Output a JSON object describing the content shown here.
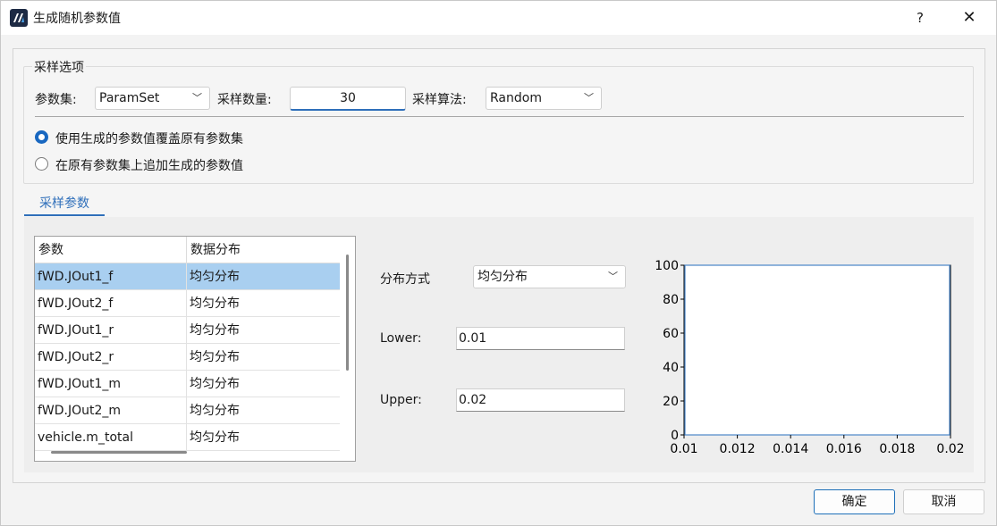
{
  "window": {
    "title": "生成随机参数值",
    "help_label": "?",
    "close_label": "✕"
  },
  "sampling_options": {
    "group_title": "采样选项",
    "param_set_label": "参数集:",
    "param_set_value": "ParamSet",
    "count_label": "采样数量:",
    "count_value": "30",
    "algorithm_label": "采样算法:",
    "algorithm_value": "Random",
    "radio_overwrite_label": "使用生成的参数值覆盖原有参数集",
    "radio_append_label": "在原有参数集上追加生成的参数值",
    "radio_overwrite_selected": true
  },
  "tab": {
    "label": "采样参数"
  },
  "table": {
    "headers": [
      "参数",
      "数据分布"
    ],
    "rows": [
      {
        "param": "fWD.JOut1_f",
        "dist": "均匀分布",
        "selected": true
      },
      {
        "param": "fWD.JOut2_f",
        "dist": "均匀分布",
        "selected": false
      },
      {
        "param": "fWD.JOut1_r",
        "dist": "均匀分布",
        "selected": false
      },
      {
        "param": "fWD.JOut2_r",
        "dist": "均匀分布",
        "selected": false
      },
      {
        "param": "fWD.JOut1_m",
        "dist": "均匀分布",
        "selected": false
      },
      {
        "param": "fWD.JOut2_m",
        "dist": "均匀分布",
        "selected": false
      },
      {
        "param": "vehicle.m_total",
        "dist": "均匀分布",
        "selected": false
      }
    ]
  },
  "distribution": {
    "method_label": "分布方式",
    "method_value": "均匀分布",
    "lower_label": "Lower:",
    "lower_value": "0.01",
    "upper_label": "Upper:",
    "upper_value": "0.02"
  },
  "chart_data": {
    "type": "bar",
    "title": "",
    "xlabel": "",
    "ylabel": "",
    "x_ticks": [
      "0.01",
      "0.012",
      "0.014",
      "0.016",
      "0.018",
      "0.02"
    ],
    "y_ticks": [
      "0",
      "20",
      "40",
      "60",
      "80",
      "100"
    ],
    "xlim": [
      0.01,
      0.02
    ],
    "ylim": [
      0,
      100
    ],
    "bins": [
      {
        "x0": 0.01,
        "x1": 0.02,
        "value": 100
      }
    ],
    "color": "#4a86c8"
  },
  "buttons": {
    "ok": "确定",
    "cancel": "取消"
  },
  "colors": {
    "accent": "#2f6fba",
    "selection": "#a9cff0"
  }
}
